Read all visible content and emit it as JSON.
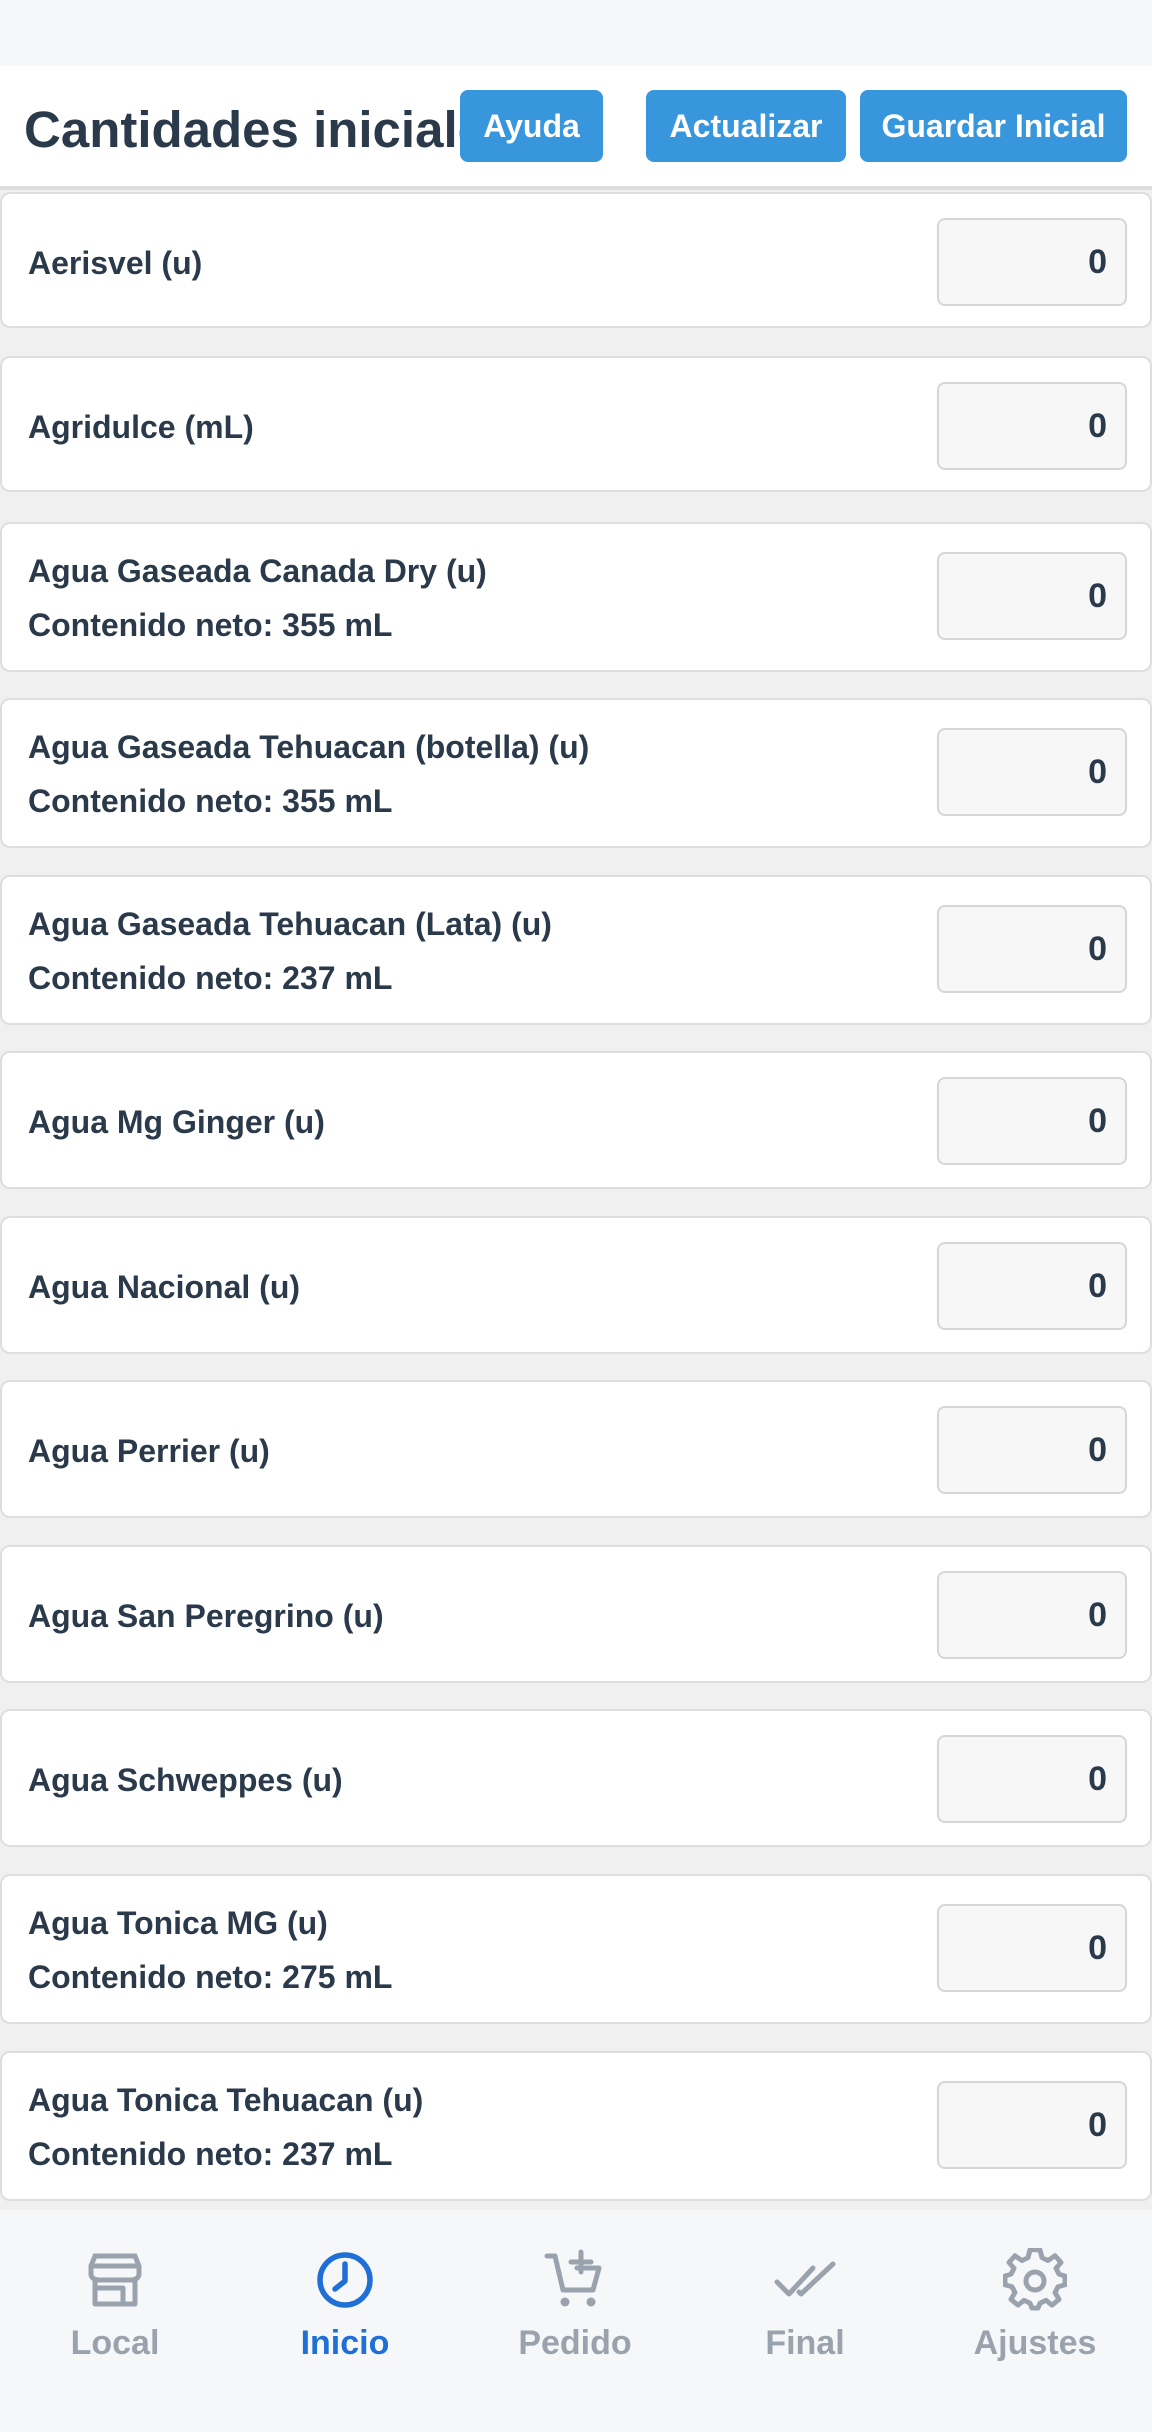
{
  "header": {
    "title": "Cantidades iniciales",
    "help_label": "Ayuda",
    "update_label": "Actualizar",
    "save_label": "Guardar Inicial"
  },
  "items": [
    {
      "name": "Aerisvel (u)",
      "detail": "",
      "value": "0"
    },
    {
      "name": "Agridulce (mL)",
      "detail": "",
      "value": "0"
    },
    {
      "name": "Agua Gaseada Canada Dry (u)",
      "detail": "Contenido neto: 355 mL",
      "value": "0"
    },
    {
      "name": "Agua Gaseada Tehuacan (botella) (u)",
      "detail": "Contenido neto: 355 mL",
      "value": "0"
    },
    {
      "name": "Agua Gaseada Tehuacan (Lata) (u)",
      "detail": "Contenido neto: 237 mL",
      "value": "0"
    },
    {
      "name": "Agua Mg Ginger (u)",
      "detail": "",
      "value": "0"
    },
    {
      "name": "Agua Nacional (u)",
      "detail": "",
      "value": "0"
    },
    {
      "name": "Agua Perrier (u)",
      "detail": "",
      "value": "0"
    },
    {
      "name": "Agua San Peregrino (u)",
      "detail": "",
      "value": "0"
    },
    {
      "name": "Agua Schweppes (u)",
      "detail": "",
      "value": "0"
    },
    {
      "name": "Agua Tonica MG (u)",
      "detail": "Contenido neto: 275 mL",
      "value": "0"
    },
    {
      "name": "Agua Tonica Tehuacan (u)",
      "detail": "Contenido neto: 237 mL",
      "value": "0"
    }
  ],
  "nav": {
    "items": [
      {
        "label": "Local",
        "icon": "store-icon",
        "active": false
      },
      {
        "label": "Inicio",
        "icon": "clock-icon",
        "active": true
      },
      {
        "label": "Pedido",
        "icon": "cart-add-icon",
        "active": false
      },
      {
        "label": "Final",
        "icon": "double-check-icon",
        "active": false
      },
      {
        "label": "Ajustes",
        "icon": "gear-icon",
        "active": false
      }
    ]
  },
  "colors": {
    "accent": "#3897dc",
    "active_nav": "#1f6fd6",
    "inactive_nav": "#9aa3ad",
    "text": "#2b3a4a"
  }
}
